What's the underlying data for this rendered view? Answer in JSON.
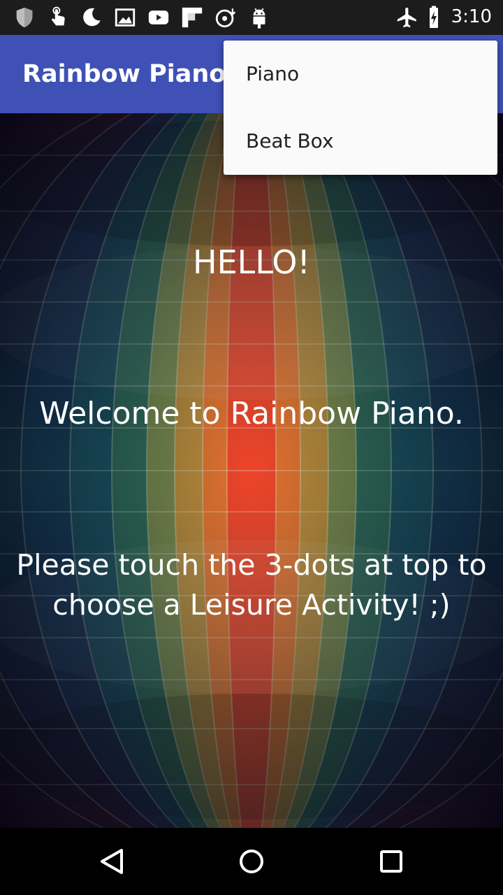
{
  "status_bar": {
    "time": "3:10",
    "icons": [
      "shield-icon",
      "touch-icon",
      "moon-icon",
      "image-icon",
      "youtube-icon",
      "flipboard-icon",
      "music-download-icon",
      "android-icon",
      "airplane-icon",
      "battery-charging-icon"
    ]
  },
  "app_bar": {
    "title": "Rainbow Piano",
    "color": "#3f51b5"
  },
  "menu": {
    "items": [
      {
        "label": "Piano"
      },
      {
        "label": "Beat Box"
      }
    ]
  },
  "content": {
    "hello": "HELLO!",
    "welcome": "Welcome to Rainbow Piano.",
    "instructions": "Please touch the 3-dots at top to choose a Leisure Activity! ;)"
  },
  "nav_bar": {
    "buttons": [
      "back-icon",
      "home-icon",
      "recents-icon"
    ]
  }
}
